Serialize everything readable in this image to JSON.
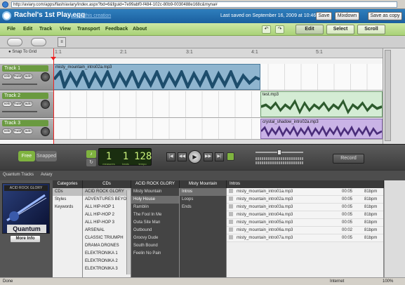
{
  "browser": {
    "url": "http://aviary.com/apps/flash/aviary/index.aspx?bd=6&fguid=7e99abf0-f484-102c-80b9-0030488e168c&myna#",
    "status": "Done",
    "zone": "Internet",
    "zoom": "100%"
  },
  "app": {
    "title": "Rachel's 1st Play.egg",
    "share_link": "share this creation",
    "last_saved": "Last saved on September 16, 2009 at 10:46 PM",
    "save": "Save",
    "mixdown": "Mixdown",
    "save_as_copy": "Save as copy"
  },
  "menu": [
    "File",
    "Edit",
    "Track",
    "View",
    "Transport",
    "Feedback",
    "About"
  ],
  "modes": {
    "edit": "Edit",
    "select": "Select",
    "scroll": "Scroll"
  },
  "timeline": {
    "snap_label": "Snap To Grid",
    "markers": [
      "1:1",
      "2:1",
      "3:1",
      "4:1",
      "5:1"
    ]
  },
  "tracks": [
    {
      "name": "Track 1",
      "solo": "solo",
      "mute": "mute",
      "auto": "auto",
      "clips": [
        {
          "label": "misty_mountain_intro02a.mp3",
          "color": "#8fb5cf",
          "wave": "#1d4d6c"
        }
      ]
    },
    {
      "name": "Track 2",
      "solo": "solo",
      "mute": "mute",
      "auto": "auto",
      "clips": [
        {
          "label": "test.mp3",
          "color": "#d4ecd4",
          "wave": "#2d5a2d"
        }
      ]
    },
    {
      "name": "Track 3",
      "solo": "solo",
      "mute": "mute",
      "auto": "auto",
      "clips": [
        {
          "label": "crystal_shadow_intro02a.mp3",
          "color": "#c9b3e6",
          "wave": "#4a2d7a"
        }
      ]
    }
  ],
  "transport": {
    "free": "Free",
    "snapped": "Snapped",
    "measures": "1",
    "beats": "1",
    "tempo": "128",
    "measures_label": "measures",
    "beats_label": "beats",
    "tempo_label": "tempo",
    "record": "Record"
  },
  "lower_tabs": [
    "Quantum Tracks",
    "Aviary"
  ],
  "library": {
    "pack_name": "Quantum",
    "more_info": "More Info",
    "banner_text": "ACID ROCK GLORY",
    "categories_header": "Categories",
    "categories": [
      "CDs",
      "Styles",
      "Keywords"
    ],
    "cds_header": "CDs",
    "cds": [
      "ACID ROCK GLORY",
      "ADVENTURES BEYON",
      "ALL HIP-HOP 1",
      "ALL HIP-HOP 2",
      "ALL HIP-HOP 3",
      "ARSENAL",
      "CLASSIC TRIUMPH",
      "DRAMA DRONES",
      "ELEKTRONIKA 1",
      "ELEKTRONIKA 2",
      "ELEKTRONIKA 3"
    ],
    "song_header": "ACID ROCK GLORY",
    "songs": [
      "Misty Mountain",
      "Holy House",
      "Ramblin",
      "The Fool In Me",
      "Outa Site Man",
      "Outbound",
      "Groovy Dude",
      "South Bound",
      "Feelin No Pain"
    ],
    "section_header": "Misty Mountain",
    "sections": [
      "Intros",
      "Loops",
      "Ends"
    ],
    "files_header": "Intros",
    "files": [
      {
        "name": "misty_mountain_intro01a.mp3",
        "dur": "00:05",
        "bpm": "81bpm"
      },
      {
        "name": "misty_mountain_intro02a.mp3",
        "dur": "00:05",
        "bpm": "81bpm"
      },
      {
        "name": "misty_mountain_intro03a.mp3",
        "dur": "00:05",
        "bpm": "81bpm"
      },
      {
        "name": "misty_mountain_intro04a.mp3",
        "dur": "00:05",
        "bpm": "81bpm"
      },
      {
        "name": "misty_mountain_intro05a.mp3",
        "dur": "00:05",
        "bpm": "81bpm"
      },
      {
        "name": "misty_mountain_intro06a.mp3",
        "dur": "00:02",
        "bpm": "81bpm"
      },
      {
        "name": "misty_mountain_intro07a.mp3",
        "dur": "00:05",
        "bpm": "81bpm"
      }
    ]
  }
}
